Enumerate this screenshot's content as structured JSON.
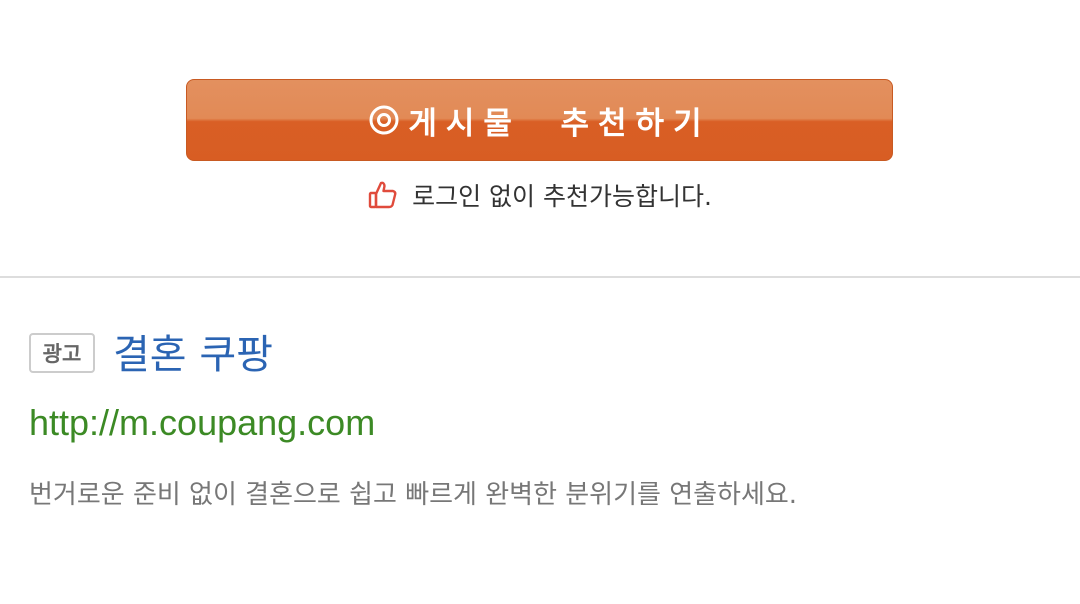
{
  "recommend": {
    "button_label": "게시물  추천하기",
    "icon": "target-circle-icon",
    "hint_icon": "thumbs-up-icon",
    "hint_text": "로그인 없이 추천가능합니다."
  },
  "ad": {
    "badge": "광고",
    "title": "결혼 쿠팡",
    "url": "http://m.coupang.com",
    "description": "번거로운 준비 없이 결혼으로 쉽고 빠르게 완벽한 분위기를 연출하세요."
  },
  "colors": {
    "button_orange": "#d95f25",
    "button_orange_light": "#e3905f",
    "title_blue": "#2b64b3",
    "url_green": "#3c8a25",
    "thumb_red": "#e04b3c"
  }
}
